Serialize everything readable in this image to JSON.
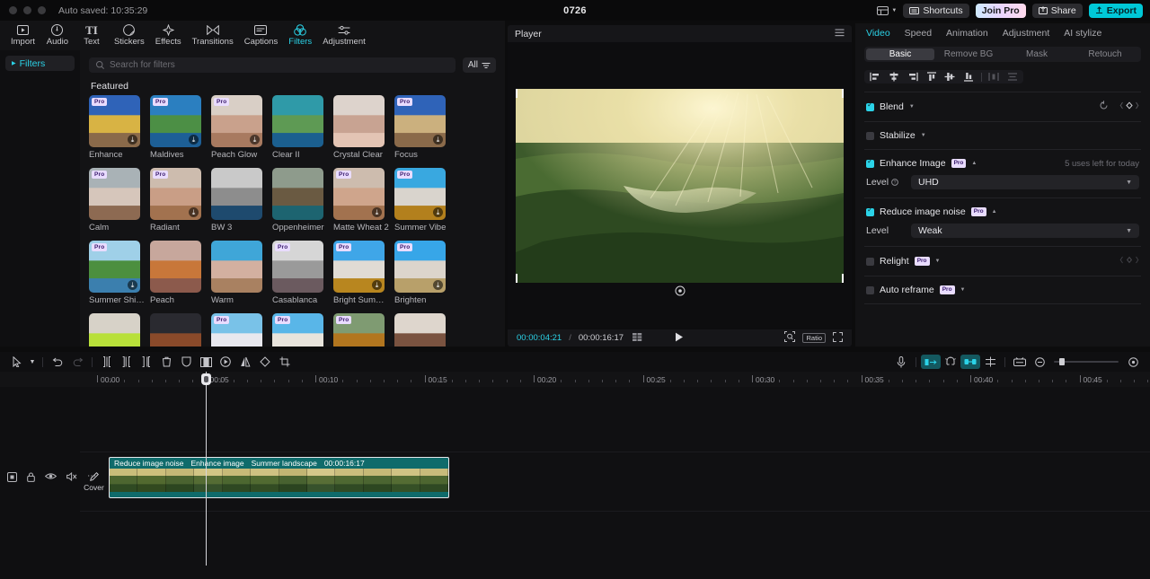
{
  "titlebar": {
    "autosave": "Auto saved: 10:35:29",
    "project_title": "0726",
    "shortcuts_label": "Shortcuts",
    "join_pro_label": "Join Pro",
    "share_label": "Share",
    "export_label": "Export",
    "accent": "#00c8d7"
  },
  "tooltabs": [
    {
      "label": "Import",
      "icon": "import-icon",
      "active": false
    },
    {
      "label": "Audio",
      "icon": "audio-icon",
      "active": false
    },
    {
      "label": "Text",
      "icon": "text-icon",
      "active": false
    },
    {
      "label": "Stickers",
      "icon": "stickers-icon",
      "active": false
    },
    {
      "label": "Effects",
      "icon": "effects-icon",
      "active": false
    },
    {
      "label": "Transitions",
      "icon": "transitions-icon",
      "active": false
    },
    {
      "label": "Captions",
      "icon": "captions-icon",
      "active": false
    },
    {
      "label": "Filters",
      "icon": "filters-icon",
      "active": true
    },
    {
      "label": "Adjustment",
      "icon": "adjustment-icon",
      "active": false
    }
  ],
  "sidebar": {
    "items": [
      {
        "label": "Filters",
        "active": true
      }
    ]
  },
  "browser": {
    "search_placeholder": "Search for filters",
    "filter_button_label": "All",
    "section_title": "Featured",
    "filters": [
      {
        "name": "Enhance",
        "pro": true,
        "download": true,
        "c1": "#2f63b8",
        "c2": "#d8b344",
        "c3": "#8a6a4a"
      },
      {
        "name": "Maldives",
        "pro": true,
        "download": true,
        "c1": "#2b7fc0",
        "c2": "#4c8f45",
        "c3": "#1d5f96"
      },
      {
        "name": "Peach Glow",
        "pro": true,
        "download": true,
        "c1": "#d9cfc6",
        "c2": "#c9a18c",
        "c3": "#a87a60"
      },
      {
        "name": "Clear II",
        "pro": false,
        "download": false,
        "c1": "#2f9aa8",
        "c2": "#5e9a54",
        "c3": "#1b5f8f"
      },
      {
        "name": "Crystal Clear",
        "pro": false,
        "download": false,
        "c1": "#ddd3cc",
        "c2": "#c8a392",
        "c3": "#e3c4b4"
      },
      {
        "name": "Focus",
        "pro": true,
        "download": true,
        "c1": "#2f63b8",
        "c2": "#cbb07e",
        "c3": "#8a6a4a"
      },
      {
        "name": "Calm",
        "pro": true,
        "download": false,
        "c1": "#a9b2b6",
        "c2": "#d6c6bb",
        "c3": "#8d6a52"
      },
      {
        "name": "Radiant",
        "pro": true,
        "download": true,
        "c1": "#cdbcae",
        "c2": "#c99e86",
        "c3": "#a2724f"
      },
      {
        "name": "BW 3",
        "pro": false,
        "download": false,
        "c1": "#c9c9c9",
        "c2": "#8d8d8d",
        "c3": "#1e4a6e"
      },
      {
        "name": "Oppenheimer",
        "pro": false,
        "download": false,
        "c1": "#8e9b8c",
        "c2": "#6a5a42",
        "c3": "#1d6470"
      },
      {
        "name": "Matte Wheat 2",
        "pro": true,
        "download": true,
        "c1": "#cdbcae",
        "c2": "#cfa58c",
        "c3": "#a2724f"
      },
      {
        "name": "Summer Vibe",
        "pro": true,
        "download": true,
        "c1": "#39a8e0",
        "c2": "#d9d4cd",
        "c3": "#b3801d"
      },
      {
        "name": "Summer Shine",
        "pro": true,
        "download": true,
        "c1": "#9fd0e8",
        "c2": "#4c8f3f",
        "c3": "#3b7fae"
      },
      {
        "name": "Peach",
        "pro": false,
        "download": false,
        "c1": "#c7a79c",
        "c2": "#c8773a",
        "c3": "#8c5a4c"
      },
      {
        "name": "Warm",
        "pro": false,
        "download": false,
        "c1": "#3fa6d8",
        "c2": "#d3b0a0",
        "c3": "#a98161"
      },
      {
        "name": "Casablanca",
        "pro": true,
        "download": false,
        "c1": "#d6d6d6",
        "c2": "#9a9a9a",
        "c3": "#6b5a5f"
      },
      {
        "name": "Bright Summer",
        "pro": true,
        "download": true,
        "c1": "#3fa6e8",
        "c2": "#e0dbd4",
        "c3": "#b8861f"
      },
      {
        "name": "Brighten",
        "pro": true,
        "download": true,
        "c1": "#37a6e8",
        "c2": "#dcd5cc",
        "c3": "#b8a06a"
      }
    ],
    "filters_row4": [
      {
        "name": "",
        "pro": false,
        "download": false,
        "c1": "#d7d2c8",
        "c2": "#b8e03a",
        "c3": "#cfc8bc"
      },
      {
        "name": "",
        "pro": false,
        "download": false,
        "c1": "#2a2a30",
        "c2": "#8a4a2a",
        "c3": "#3a3a42"
      },
      {
        "name": "",
        "pro": true,
        "download": false,
        "c1": "#79c2e8",
        "c2": "#e8e8ee",
        "c3": "#4c8f3f"
      },
      {
        "name": "",
        "pro": true,
        "download": false,
        "c1": "#59b6e8",
        "c2": "#e8e4dc",
        "c3": "#d9cfc2"
      },
      {
        "name": "",
        "pro": true,
        "download": false,
        "c1": "#7f9b72",
        "c2": "#b2761f",
        "c3": "#c09a3a"
      },
      {
        "name": "",
        "pro": false,
        "download": false,
        "c1": "#ded6cd",
        "c2": "#7a5340",
        "c3": "#e6e0d6"
      }
    ]
  },
  "player": {
    "title": "Player",
    "current_time": "00:00:04:21",
    "separator": "/",
    "total_time": "00:00:16:17",
    "ratio_label": "Ratio"
  },
  "rightpanel": {
    "tabs": [
      {
        "label": "Video",
        "active": true
      },
      {
        "label": "Speed",
        "active": false
      },
      {
        "label": "Animation",
        "active": false
      },
      {
        "label": "Adjustment",
        "active": false
      },
      {
        "label": "AI stylize",
        "active": false
      }
    ],
    "segments": [
      {
        "label": "Basic",
        "active": true
      },
      {
        "label": "Remove BG",
        "active": false
      },
      {
        "label": "Mask",
        "active": false
      },
      {
        "label": "Retouch",
        "active": false
      }
    ],
    "align_icons": [
      "align-left-icon",
      "align-center-horizontal-icon",
      "align-right-icon",
      "align-top-icon",
      "align-center-vertical-icon",
      "align-bottom-icon",
      "distribute-horizontal-icon",
      "distribute-vertical-icon"
    ],
    "properties": [
      {
        "name": "Blend",
        "checked": true,
        "pro": false,
        "note": "",
        "keyframe": true
      },
      {
        "name": "Stabilize",
        "checked": false,
        "pro": false,
        "note": "",
        "keyframe": false
      },
      {
        "name": "Enhance Image",
        "checked": true,
        "pro": true,
        "note": "5 uses left for today",
        "keyframe": false
      },
      {
        "name": "Reduce image noise",
        "checked": true,
        "pro": true,
        "note": "",
        "keyframe": false
      },
      {
        "name": "Relight",
        "checked": false,
        "pro": true,
        "note": "",
        "keyframe": true
      },
      {
        "name": "Auto reframe",
        "checked": false,
        "pro": true,
        "note": "",
        "keyframe": false
      }
    ],
    "enhance_level": {
      "label": "Level",
      "value": "UHD"
    },
    "noise_level": {
      "label": "Level",
      "value": "Weak"
    },
    "pro_tag": "Pro"
  },
  "timeline": {
    "ruler_labels": [
      "00:00",
      "00:05",
      "00:10",
      "00:15",
      "00:20",
      "00:25",
      "00:30",
      "00:35",
      "00:40",
      "00:45"
    ],
    "cover_label": "Cover",
    "clip": {
      "effect1": "Reduce image noise",
      "effect2": "Enhance image",
      "name": "Summer landscape",
      "duration": "00:00:16:17"
    }
  }
}
